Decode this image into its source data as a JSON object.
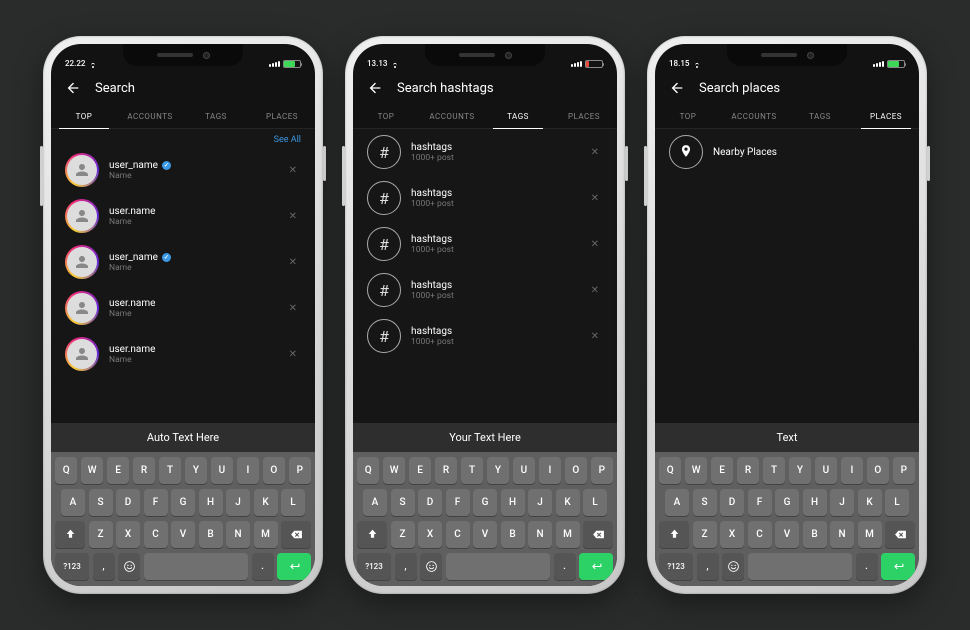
{
  "keyboard": {
    "r1": [
      "Q",
      "W",
      "E",
      "R",
      "T",
      "Y",
      "U",
      "I",
      "O",
      "P"
    ],
    "r2": [
      "A",
      "S",
      "D",
      "F",
      "G",
      "H",
      "J",
      "K",
      "L"
    ],
    "r3_mid": [
      "Z",
      "X",
      "C",
      "V",
      "B",
      "N",
      "M"
    ],
    "sym": "?123",
    "comma": ",",
    "dot": "."
  },
  "tabs": [
    "TOP",
    "ACCOUNTS",
    "TAGS",
    "PLACES"
  ],
  "phones": [
    {
      "time": "22.22",
      "battery": "g",
      "title": "Search",
      "active_tab": 0,
      "see_all": "See All",
      "list_type": "accounts",
      "list": [
        {
          "primary": "user_name",
          "secondary": "Name",
          "verified": true
        },
        {
          "primary": "user.name",
          "secondary": "Name",
          "verified": false
        },
        {
          "primary": "user_name",
          "secondary": "Name",
          "verified": true
        },
        {
          "primary": "user.name",
          "secondary": "Name",
          "verified": false
        },
        {
          "primary": "user.name",
          "secondary": "Name",
          "verified": false
        }
      ],
      "suggest": "Auto Text Here"
    },
    {
      "time": "13.13",
      "battery": "r",
      "title": "Search hashtags",
      "active_tab": 2,
      "list_type": "hashtags",
      "list": [
        {
          "primary": "hashtags",
          "secondary": "1000+ post"
        },
        {
          "primary": "hashtags",
          "secondary": "1000+ post"
        },
        {
          "primary": "hashtags",
          "secondary": "1000+ post"
        },
        {
          "primary": "hashtags",
          "secondary": "1000+ post"
        },
        {
          "primary": "hashtags",
          "secondary": "1000+ post"
        }
      ],
      "suggest": "Your Text Here"
    },
    {
      "time": "18.15",
      "battery": "g",
      "title": "Search places",
      "active_tab": 3,
      "list_type": "places",
      "list": [
        {
          "primary": "Nearby Places"
        }
      ],
      "suggest": "Text"
    }
  ]
}
